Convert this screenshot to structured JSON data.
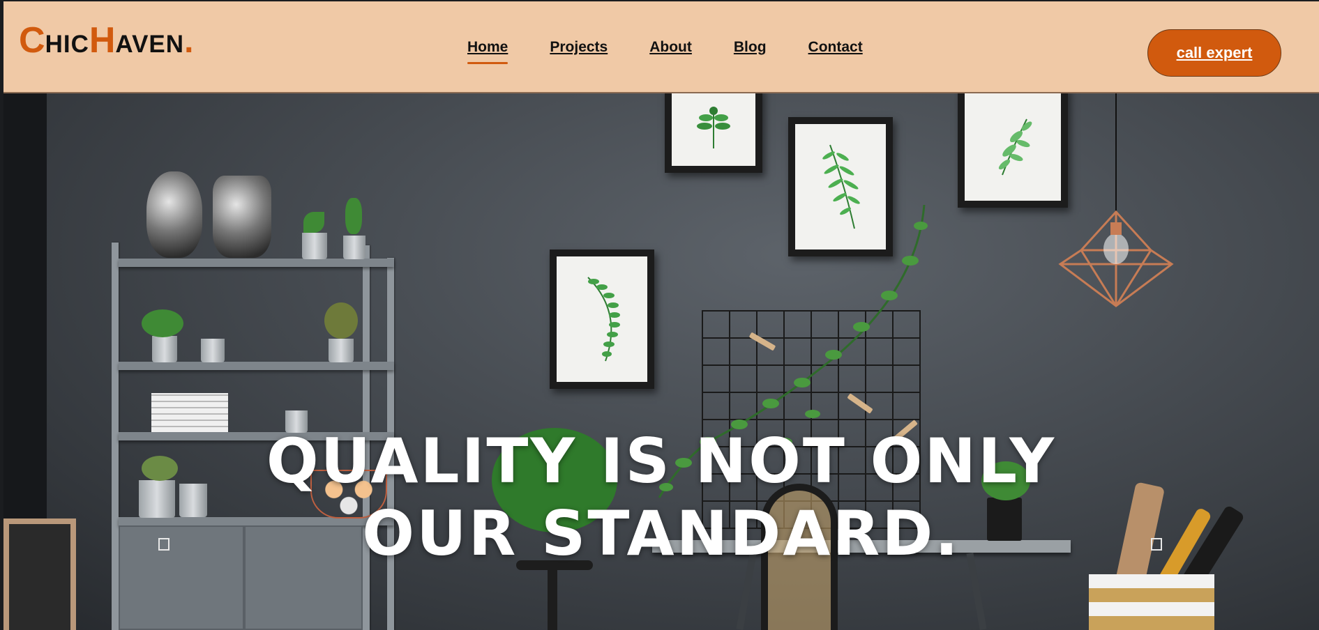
{
  "logo": {
    "c": "C",
    "hic": "HIC",
    "h": "H",
    "aven": "AVEN",
    "dot": "."
  },
  "nav": {
    "items": [
      {
        "label": "Home",
        "active": true
      },
      {
        "label": "Projects",
        "active": false
      },
      {
        "label": "About",
        "active": false
      },
      {
        "label": "Blog",
        "active": false
      },
      {
        "label": "Contact",
        "active": false
      }
    ]
  },
  "cta": {
    "label": "call expert"
  },
  "hero": {
    "headline_line1": "QUALITY IS NOT ONLY",
    "headline_line2": "OUR STANDARD."
  },
  "colors": {
    "header_bg": "#f0c9a6",
    "accent": "#d15a0e",
    "text_dark": "#111111",
    "headline": "#ffffff"
  }
}
